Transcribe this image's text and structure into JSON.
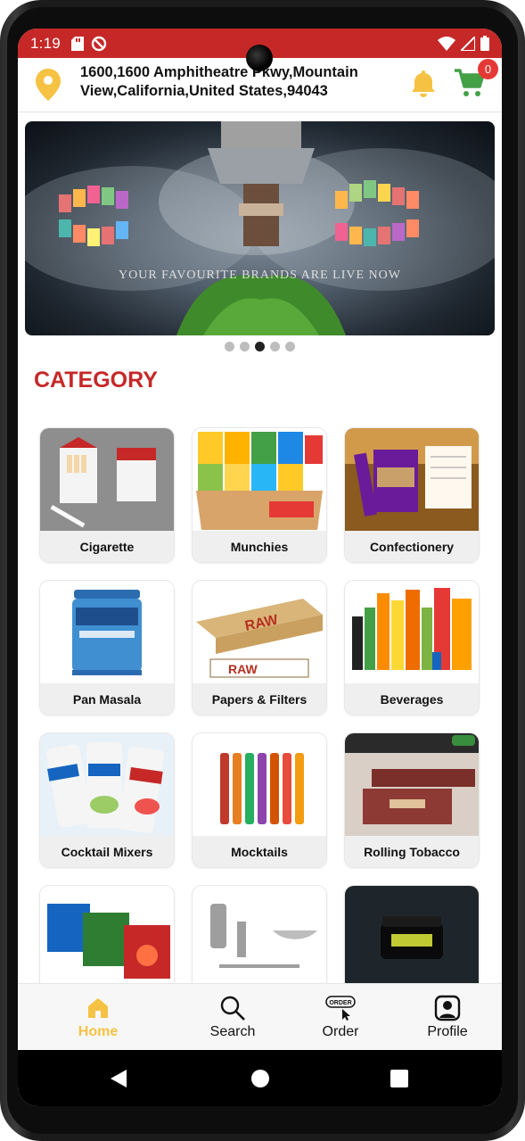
{
  "status_bar": {
    "time": "1:19",
    "icons": [
      "sd-card-icon",
      "blocked-icon",
      "wifi-icon",
      "signal-icon",
      "battery-icon"
    ]
  },
  "header": {
    "address": "1600,1600 Amphitheatre Pkwy,Mountain View,California,United States,94043",
    "cart_count": "0",
    "colors": {
      "location": "#f6c243",
      "bell": "#f6c243",
      "cart": "#43a047",
      "badge": "#e53935"
    }
  },
  "banner": {
    "text": "YOUR FAVOURITE BRANDS ARE LIVE NOW",
    "slides": 5,
    "active_slide": 3
  },
  "section": {
    "title": "CATEGORY"
  },
  "categories": [
    {
      "label": "Cigarette"
    },
    {
      "label": "Munchies"
    },
    {
      "label": "Confectionery"
    },
    {
      "label": "Pan Masala"
    },
    {
      "label": "Papers & Filters"
    },
    {
      "label": "Beverages"
    },
    {
      "label": "Cocktail Mixers"
    },
    {
      "label": "Mocktails"
    },
    {
      "label": "Rolling Tobacco"
    }
  ],
  "bottom_nav": [
    {
      "label": "Home",
      "icon": "home-icon",
      "active": true
    },
    {
      "label": "Search",
      "icon": "search-icon",
      "active": false
    },
    {
      "label": "Order",
      "icon": "order-icon",
      "active": false
    },
    {
      "label": "Profile",
      "icon": "profile-icon",
      "active": false
    }
  ],
  "colors": {
    "accent_red": "#c62828",
    "active_nav": "#f6c243"
  }
}
